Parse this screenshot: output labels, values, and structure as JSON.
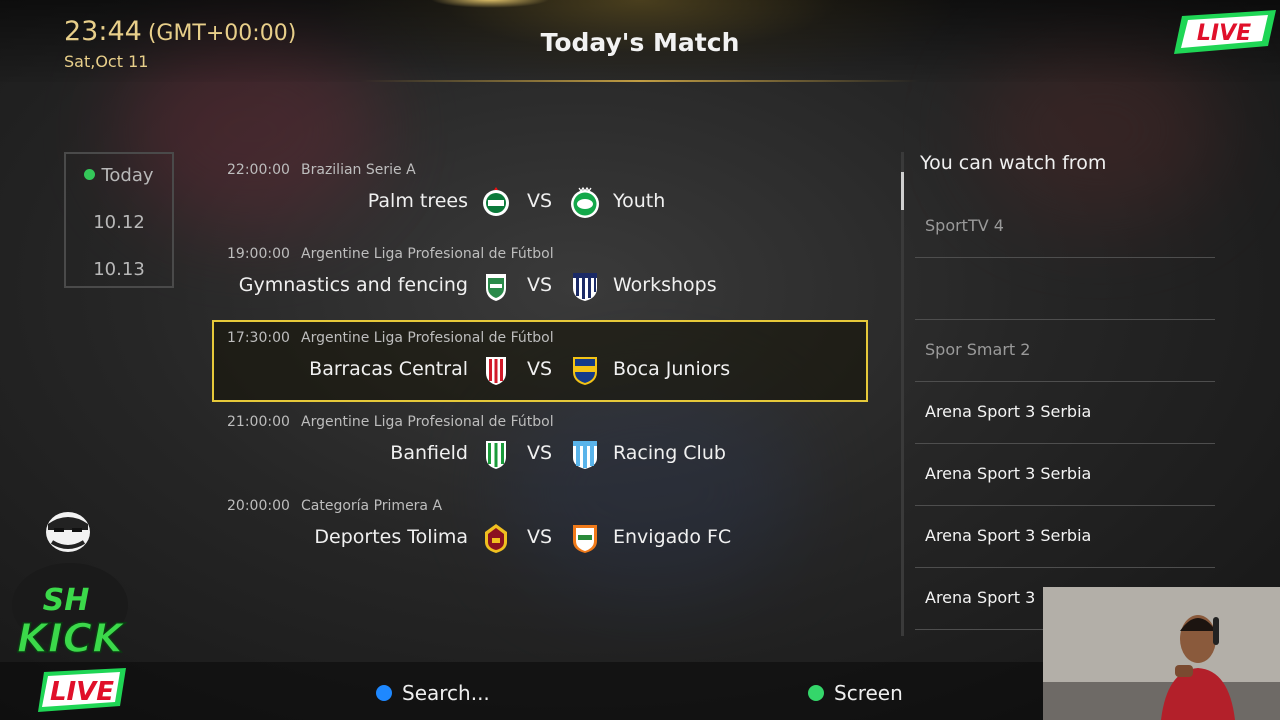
{
  "header": {
    "time": "23:44",
    "timezone": "(GMT+00:00)",
    "date": "Sat,Oct 11",
    "title": "Today's Match"
  },
  "date_tabs": [
    {
      "label": "Today",
      "active": true
    },
    {
      "label": "10.12",
      "active": false
    },
    {
      "label": "10.13",
      "active": false
    }
  ],
  "matches": [
    {
      "time": "22:00:00",
      "league": "Brazilian Serie A",
      "home": "Palm trees",
      "home_crest": "palmeiras-crest-icon",
      "vs": "VS",
      "away": "Youth",
      "away_crest": "juventude-crest-icon",
      "selected": false
    },
    {
      "time": "19:00:00",
      "league": "Argentine Liga Profesional de Fútbol",
      "home": "Gymnastics and fencing",
      "home_crest": "gimnasia-crest-icon",
      "vs": "VS",
      "away": "Workshops",
      "away_crest": "talleres-crest-icon",
      "selected": false
    },
    {
      "time": "17:30:00",
      "league": "Argentine Liga Profesional de Fútbol",
      "home": "Barracas Central",
      "home_crest": "barracas-central-crest-icon",
      "vs": "VS",
      "away": "Boca Juniors",
      "away_crest": "boca-juniors-crest-icon",
      "selected": true
    },
    {
      "time": "21:00:00",
      "league": "Argentine Liga Profesional de Fútbol",
      "home": "Banfield",
      "home_crest": "banfield-crest-icon",
      "vs": "VS",
      "away": "Racing Club",
      "away_crest": "racing-club-crest-icon",
      "selected": false
    },
    {
      "time": "20:00:00",
      "league": "Categoría Primera A",
      "home": "Deportes Tolima",
      "home_crest": "deportes-tolima-crest-icon",
      "vs": "VS",
      "away": "Envigado FC",
      "away_crest": "envigado-crest-icon",
      "selected": false
    }
  ],
  "watch_panel": {
    "title": "You can watch from",
    "channels": [
      {
        "name": "SportTV 4",
        "style": "dim"
      },
      {
        "name": "",
        "style": "dim"
      },
      {
        "name": "Spor Smart 2",
        "style": "dim"
      },
      {
        "name": "Arena Sport 3 Serbia",
        "style": "bright"
      },
      {
        "name": "Arena Sport 3 Serbia",
        "style": "bright"
      },
      {
        "name": "Arena Sport 3 Serbia",
        "style": "bright"
      },
      {
        "name": "Arena Sport 3",
        "style": "bright"
      }
    ]
  },
  "footer": {
    "search_label": "Search...",
    "search_color": "#1e88ff",
    "screen_label": "Screen",
    "screen_color": "#34d66a"
  },
  "overlays": {
    "live_badge": "LIVE",
    "streamer_logo_top": "SH",
    "streamer_logo_mid": "KICK",
    "streamer_logo_bottom": "LIVE"
  },
  "colors": {
    "clock": "#e8cf8a",
    "selection_border": "#e6c93a",
    "active_dot": "#34c759",
    "live_green": "#1fd655",
    "live_red": "#e0102a"
  }
}
